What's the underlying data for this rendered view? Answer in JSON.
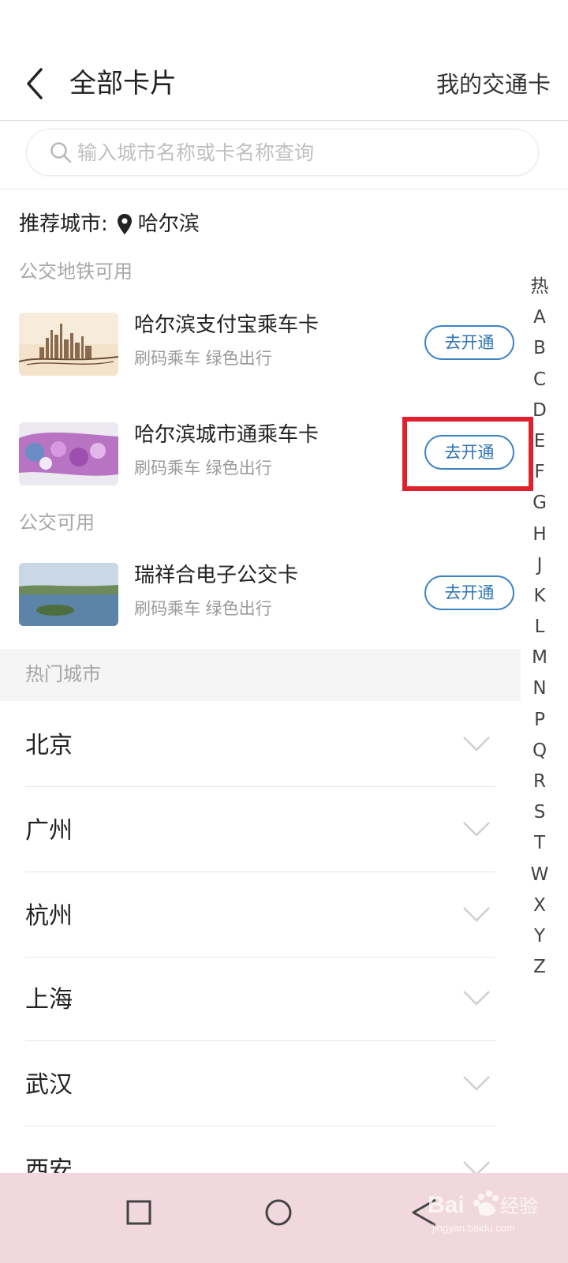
{
  "header": {
    "title": "全部卡片",
    "right_link": "我的交通卡"
  },
  "search": {
    "placeholder": "输入城市名称或卡名称查询",
    "value": ""
  },
  "recommend": {
    "label": "推荐城市:",
    "city": "哈尔滨"
  },
  "sections": {
    "bus_metro": "公交地铁可用",
    "bus_only": "公交可用",
    "hot_cities": "热门城市"
  },
  "cards": [
    {
      "name": "哈尔滨支付宝乘车卡",
      "subtitle": "刷码乘车 绿色出行",
      "button": "去开通"
    },
    {
      "name": "哈尔滨城市通乘车卡",
      "subtitle": "刷码乘车 绿色出行",
      "button": "去开通"
    },
    {
      "name": "瑞祥合电子公交卡",
      "subtitle": "刷码乘车 绿色出行",
      "button": "去开通"
    }
  ],
  "hot_cities": [
    "北京",
    "广州",
    "杭州",
    "上海",
    "武汉",
    "西安"
  ],
  "index_letters": [
    "热",
    "A",
    "B",
    "C",
    "D",
    "E",
    "F",
    "G",
    "H",
    "J",
    "K",
    "L",
    "M",
    "N",
    "P",
    "Q",
    "R",
    "S",
    "T",
    "W",
    "X",
    "Y",
    "Z"
  ],
  "watermark": {
    "brand": "Bai",
    "brand_suffix": "经验",
    "domain": "jingyan.baidu.com"
  },
  "colors": {
    "accent_blue": "#2f74b5",
    "highlight_red": "#e0202c",
    "nav_bg": "#f1d8de"
  },
  "icons": {
    "back": "chevron-left-icon",
    "search": "magnifier-icon",
    "location": "map-pin-icon",
    "expand": "chevron-down-icon",
    "nav_recent": "square-icon",
    "nav_home": "circle-icon",
    "nav_back": "triangle-left-icon"
  }
}
